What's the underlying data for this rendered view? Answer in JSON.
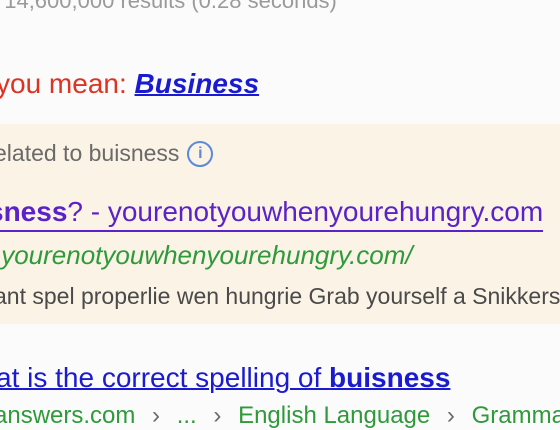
{
  "results_stats": "t 14,600,000 results (0.28 seconds)",
  "did_you_mean": {
    "prefix": "you mean: ",
    "suggestion": "Business"
  },
  "ads": {
    "label": "elated to buisness",
    "info_icon": "info-icon",
    "ad": {
      "title_bold": "sness",
      "title_rest": "? - yourenotyouwhenyourehungry.com",
      "display_url": ".yourenotyouwhenyourehungry.com/",
      "description": "ant spel properlie wen hungrie Grab yourself a Snikkers"
    }
  },
  "organic_result": {
    "title_prefix": "at is the correct spelling of ",
    "title_bold": "buisness",
    "breadcrumbs": [
      "answers.com",
      "›",
      "...",
      "›",
      "English Language",
      "›",
      "Grammar"
    ]
  },
  "colors": {
    "link_blue": "#1a1ad0",
    "visited_purple": "#5a22c8",
    "url_green": "#2e9a3a",
    "dym_red": "#dd3322",
    "ad_bg": "#faf3e6"
  }
}
